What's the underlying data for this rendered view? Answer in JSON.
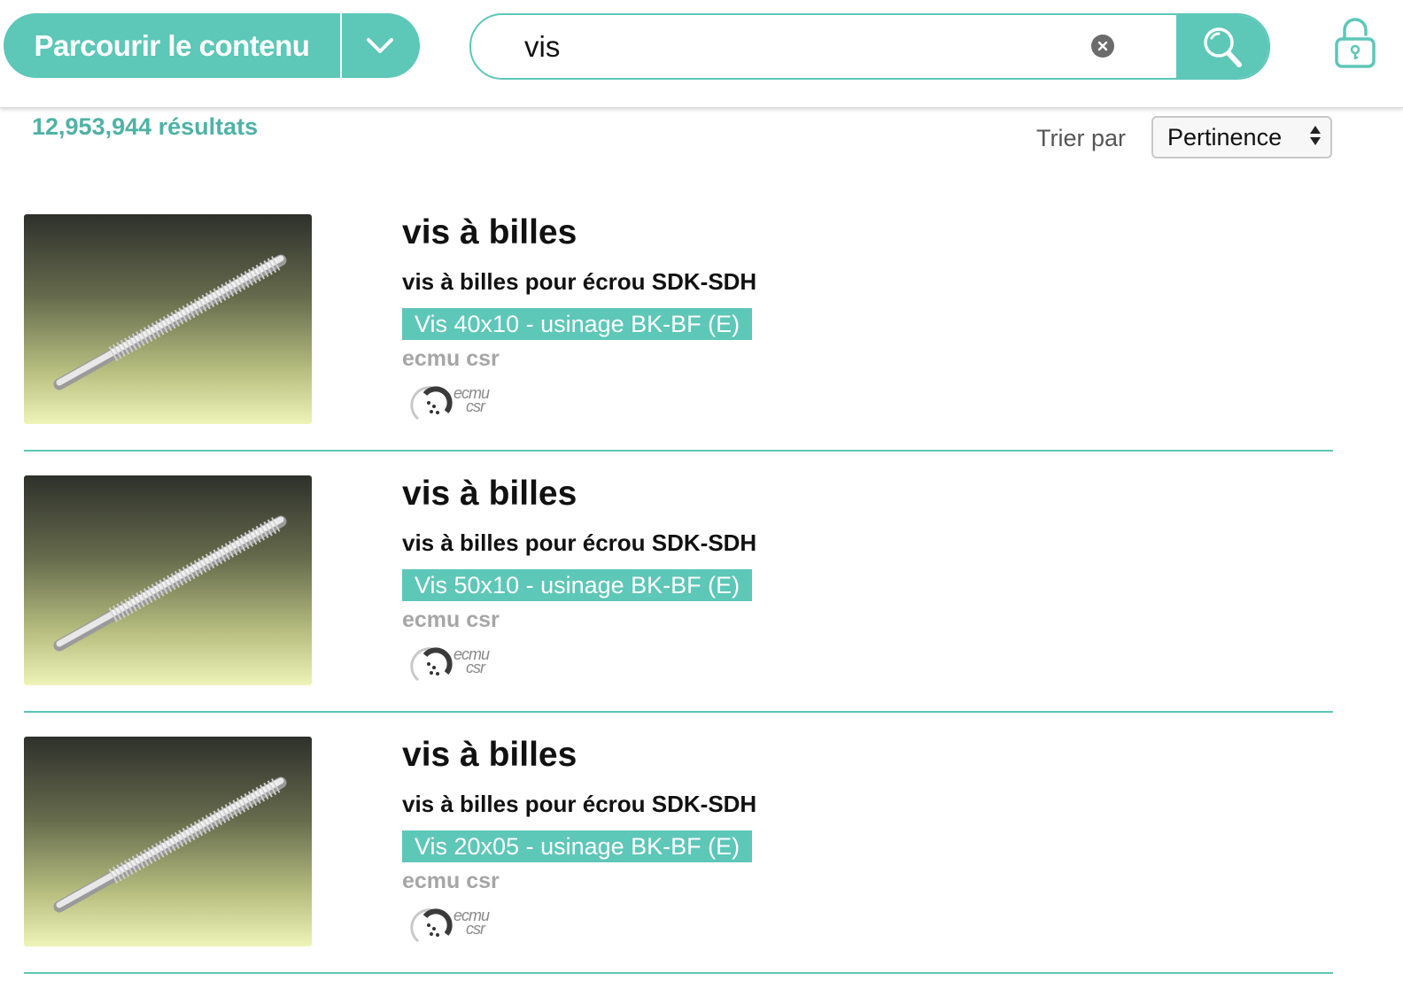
{
  "header": {
    "browse_label": "Parcourir le contenu",
    "search": {
      "value": "vis",
      "placeholder": ""
    }
  },
  "results": {
    "count_label": "12,953,944 résultats",
    "sort_label": "Trier par",
    "sort_value": "Pertinence",
    "items": [
      {
        "title": "vis à billes",
        "subtitle": "vis à billes pour écrou SDK-SDH",
        "tag": "Vis 40x10 - usinage BK-BF (E)",
        "vendor": "ecmu csr",
        "logo": {
          "line1": "ecmu",
          "line2": "csr"
        }
      },
      {
        "title": "vis à billes",
        "subtitle": "vis à billes pour écrou SDK-SDH",
        "tag": "Vis 50x10 - usinage BK-BF (E)",
        "vendor": "ecmu csr",
        "logo": {
          "line1": "ecmu",
          "line2": "csr"
        }
      },
      {
        "title": "vis à billes",
        "subtitle": "vis à billes pour écrou SDK-SDH",
        "tag": "Vis 20x05 - usinage BK-BF (E)",
        "vendor": "ecmu csr",
        "logo": {
          "line1": "ecmu",
          "line2": "csr"
        }
      }
    ]
  },
  "colors": {
    "accent": "#5dc7b8",
    "count_text": "#4fb2a6",
    "vendor_text": "#a6a6a6"
  },
  "icons": [
    "chevron-down-icon",
    "clear-icon",
    "search-icon",
    "lock-icon",
    "sort-arrows-icon"
  ]
}
